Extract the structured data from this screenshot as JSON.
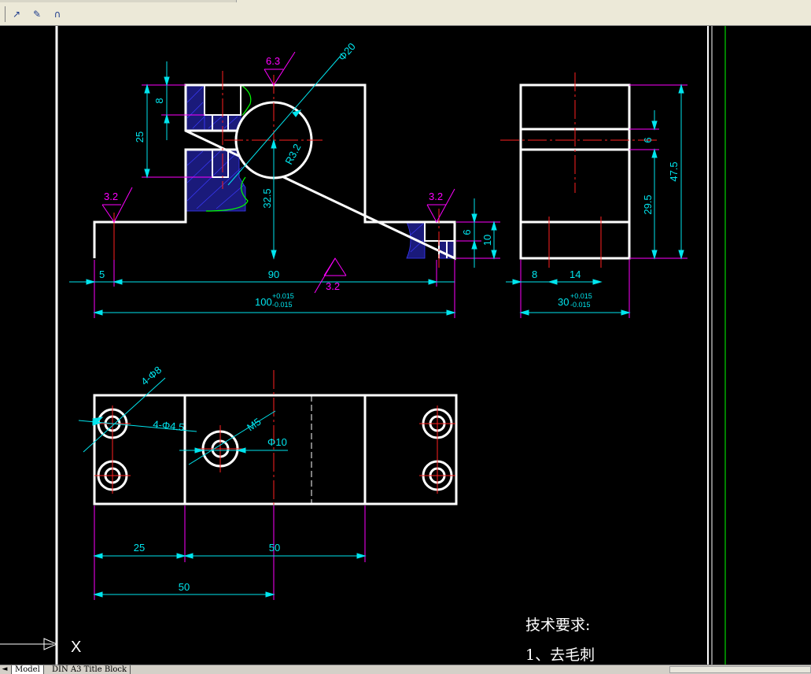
{
  "toolbar": {
    "buttons": [
      {
        "icon": "dimension-jog-icon",
        "glyph": "↗"
      },
      {
        "icon": "dimension-edit-icon",
        "glyph": "✎"
      },
      {
        "icon": "dimension-arc-icon",
        "glyph": "∩"
      }
    ]
  },
  "drawing": {
    "roughness": {
      "top": "6.3",
      "left": "3.2",
      "right": "3.2",
      "bottom": "3.2"
    },
    "dims_front": {
      "d20": "Φ20",
      "h8": "8",
      "h25": "25",
      "r32": "R3.2",
      "h32_5": "32.5",
      "h6": "6",
      "h10": "10",
      "w5": "5",
      "w90": "90",
      "w100_base": "100",
      "w100_tol_up": "+0.015",
      "w100_tol_low": "-0.015"
    },
    "dims_side": {
      "h6": "6",
      "h47_5": "47.5",
      "h29_5": "29.5",
      "w8": "8",
      "w14": "14",
      "w30_base": "30",
      "w30_tol_up": "+0.015",
      "w30_tol_low": "-0.015"
    },
    "dims_top": {
      "holes_d8": "4-Φ8",
      "holes_d4_5": "4-Φ4.5",
      "m5": "M5",
      "d10": "Φ10",
      "w25": "25",
      "w50a": "50",
      "w50b": "50"
    },
    "notes": {
      "title": "技术要求:",
      "item1": "1、去毛刺"
    },
    "ucs_label": "X"
  },
  "tabs": {
    "model": "Model",
    "layout": "DIN A3 Title Block"
  },
  "colors": {
    "outline": "#ffffff",
    "dimension": "#00e5ee",
    "center": "#ff2020",
    "extension": "#ff00ff",
    "hatch": "#4040ff",
    "break_line": "#00ff00",
    "background": "#000000"
  }
}
